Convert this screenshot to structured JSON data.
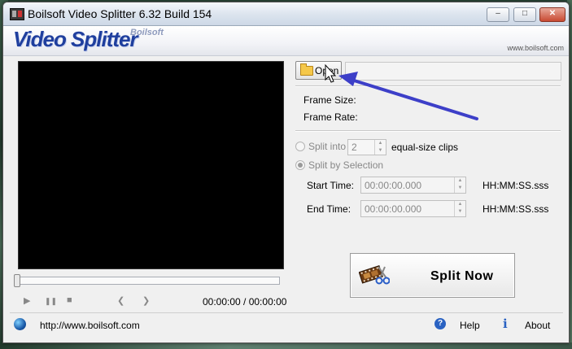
{
  "window": {
    "title": "Boilsoft Video Splitter 6.32 Build 154",
    "controls": {
      "minimize": "–",
      "maximize": "□",
      "close": "✕"
    }
  },
  "banner": {
    "logo": "Video Splitter",
    "brand": "Boilsoft",
    "url": "www.boilsoft.com"
  },
  "player": {
    "time_display": "00:00:00 / 00:00:00",
    "controls": {
      "play": "▶",
      "pause": "❚❚",
      "stop": "■",
      "prev": "❮",
      "next": "❯"
    }
  },
  "file": {
    "open_label": "Open",
    "path": ""
  },
  "info": {
    "frame_size_label": "Frame Size:",
    "frame_rate_label": "Frame Rate:"
  },
  "split_options": {
    "split_into_label": "Split into",
    "split_into_value": "2",
    "equal_size_label": "equal-size clips",
    "by_selection_label": "Split by Selection",
    "start_time_label": "Start Time:",
    "start_time_value": "00:00:00.000",
    "end_time_label": "End Time:",
    "end_time_value": "00:00:00.000",
    "format_hint": "HH:MM:SS.sss"
  },
  "action": {
    "split_now_label": "Split Now"
  },
  "footer": {
    "url": "http://www.boilsoft.com",
    "help_label": "Help",
    "about_label": "About"
  },
  "colors": {
    "logo": "#1f3f9e",
    "annotation_arrow": "#3d3fc8",
    "help_icon": "#2a62c2"
  }
}
